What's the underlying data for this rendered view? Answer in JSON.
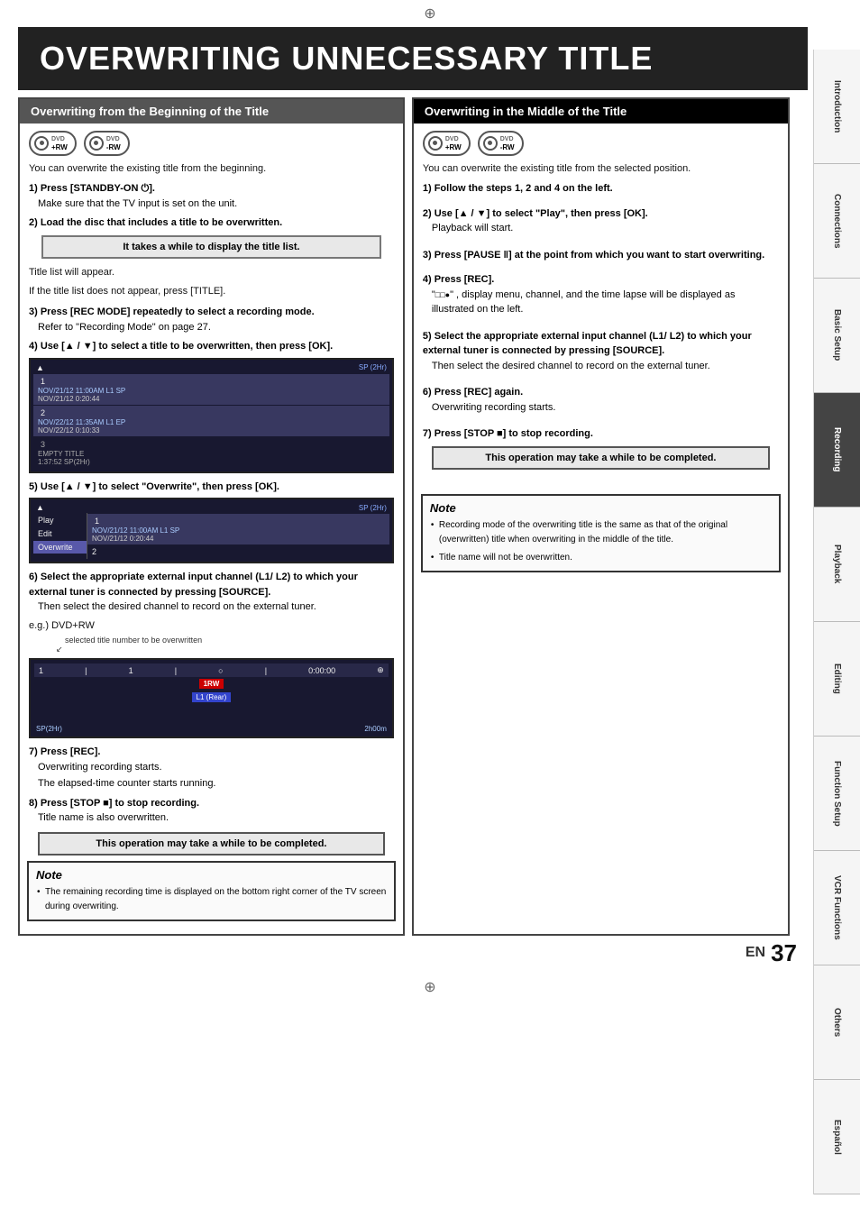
{
  "page": {
    "crosshair_top": "⊕",
    "crosshair_bottom": "⊕",
    "main_title": "OVERWRITING UNNECESSARY TITLE",
    "page_en": "EN",
    "page_number": "37"
  },
  "sidebar": {
    "items": [
      {
        "label": "Introduction"
      },
      {
        "label": "Connections"
      },
      {
        "label": "Basic Setup"
      },
      {
        "label": "Recording",
        "active": true
      },
      {
        "label": "Playback"
      },
      {
        "label": "Editing"
      },
      {
        "label": "Function Setup"
      },
      {
        "label": "VCR Functions"
      },
      {
        "label": "Others"
      },
      {
        "label": "Español"
      }
    ]
  },
  "left_section": {
    "header": "Overwriting from the Beginning of the Title",
    "dvd_icons": [
      "+RW",
      "-RW"
    ],
    "intro_text": "You can overwrite the existing title from the beginning.",
    "step1": "1) Press [STANDBY-ON ⏻].",
    "step1_sub": "Make sure that the TV input is set on the unit.",
    "step2": "2) Load the disc that includes a title to be overwritten.",
    "info_box": "It takes a while to display\nthe title list.",
    "step2b": "Title list will appear.",
    "step2c": "If the title list does not appear, press [TITLE].",
    "step3": "3) Press [REC MODE] repeatedly to select a recording mode.",
    "step3_sub": "Refer to \"Recording Mode\" on page 27.",
    "step4": "4) Use [▲ / ▼] to select a title to be overwritten, then press [OK].",
    "screen1": {
      "rows": [
        {
          "num": "1",
          "date": "NOV/21/12 11:00AM L1 SP",
          "date2": "NOV/21/12 0:20:44",
          "sp": "SP (2Hr)"
        },
        {
          "num": "2",
          "date": "NOV/22/12 11:35AM L1 EP",
          "date2": "NOV/22/12 0:10:33"
        },
        {
          "num": "3",
          "title": "EMPTY TITLE",
          "info": "1:37:52 SP(2Hr)"
        }
      ]
    },
    "step5": "5) Use [▲ / ▼] to select \"Overwrite\", then press [OK].",
    "screen2": {
      "play": "Play",
      "edit": "Edit",
      "overwrite": "Overwrite",
      "row1": {
        "num": "1",
        "date": "NOV/21/12 11:00AM L1 SP",
        "date2": "NOV/21/12 0:20:44",
        "sp": "SP (2Hr)"
      },
      "row2": "2"
    },
    "step6": "6) Select the appropriate external input channel (L1/ L2) to which your external tuner is connected by pressing [SOURCE].",
    "step6_sub": "Then select the desired channel to record on the external tuner.",
    "step6_eg": "e.g.) DVD+RW",
    "callout": "selected title number\nto be overwritten",
    "screen3": {
      "line1": "1 | 1 | ○ | 0:00:00 | ⊕",
      "label1": "1RW",
      "label2": "L1 (Rear)",
      "bottom1": "SP(2Hr)",
      "bottom2": "2h00m"
    },
    "step7": "7) Press [REC].",
    "step7_sub1": "Overwriting recording starts.",
    "step7_sub2": "The elapsed-time counter starts running.",
    "step8": "8) Press [STOP ■] to stop recording.",
    "step8_sub": "Title name is also overwritten.",
    "op_box": "This operation may take a\nwhile to be completed.",
    "note": {
      "title": "Note",
      "items": [
        "The remaining recording time is displayed on the bottom right corner of the TV screen during overwriting."
      ]
    }
  },
  "right_section": {
    "header": "Overwriting in the Middle of the Title",
    "dvd_icons": [
      "+RW",
      "-RW"
    ],
    "intro_text": "You can overwrite the existing title from the selected position.",
    "step1": "1) Follow the steps 1, 2 and 4 on the left.",
    "step2": "2) Use [▲ / ▼] to select \"Play\", then press [OK].",
    "step2_sub": "Playback will start.",
    "step3": "3) Press [PAUSE ‖] at the point from which you want to start overwriting.",
    "step4": "4) Press [REC].",
    "step4_sub": "\", display menu, channel, and the time lapse will be displayed as illustrated on the left.",
    "step5": "5) Select the appropriate external input channel (L1/ L2) to which your external tuner is connected by pressing [SOURCE].\n   Then select the desired channel to record on the external tuner.",
    "step6": "6) Press [REC] again.",
    "step6_sub": "Overwriting recording starts.",
    "step7": "7) Press [STOP ■] to stop recording.",
    "op_box": "This operation may take a\nwhile to be completed.",
    "note": {
      "title": "Note",
      "items": [
        "Recording mode of the overwriting title is the same as that of the original (overwritten) title when overwriting in the middle of the title.",
        "Title name will not be overwritten."
      ]
    }
  }
}
